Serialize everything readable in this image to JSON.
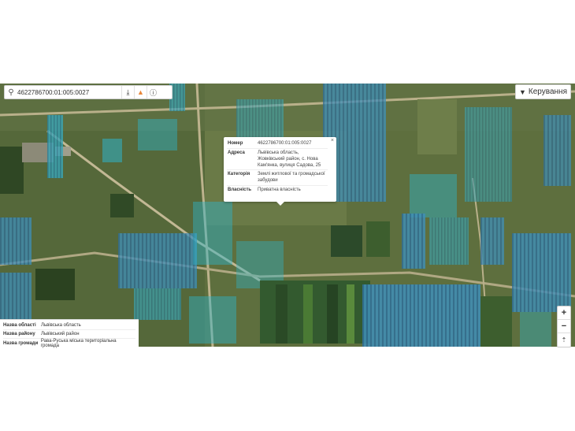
{
  "search": {
    "value": "4622786700:01:005:0027",
    "search_icon": "search-icon",
    "download_icon": "download-icon",
    "warning_icon": "warning-icon",
    "info_icon": "info-icon"
  },
  "control_button": {
    "label": "Керування",
    "icon": "filter-icon"
  },
  "popup": {
    "close_label": "×",
    "rows": [
      {
        "key": "Номер",
        "value": "4622786700:01:005:0027"
      },
      {
        "key": "Адреса",
        "value": "Львівська область, Жовківський район, с. Нова Кам'янка, вулиця Садова, 25"
      },
      {
        "key": "Категорія",
        "value": "Землі житлової та громадської забудови"
      },
      {
        "key": "Власність",
        "value": "Приватна власність"
      }
    ]
  },
  "info_panel": {
    "rows": [
      {
        "key": "Назва області",
        "value": "Львівська область"
      },
      {
        "key": "Назва району",
        "value": "Львівський район"
      },
      {
        "key": "Назва громади",
        "value": "Рава-Руська міська територіальна громада"
      }
    ]
  },
  "zoom": {
    "in_label": "+",
    "out_label": "−",
    "reset_label": "⇡"
  },
  "colors": {
    "parcel_overlay": "#2fb3c9",
    "map_base": "#5d7040"
  }
}
